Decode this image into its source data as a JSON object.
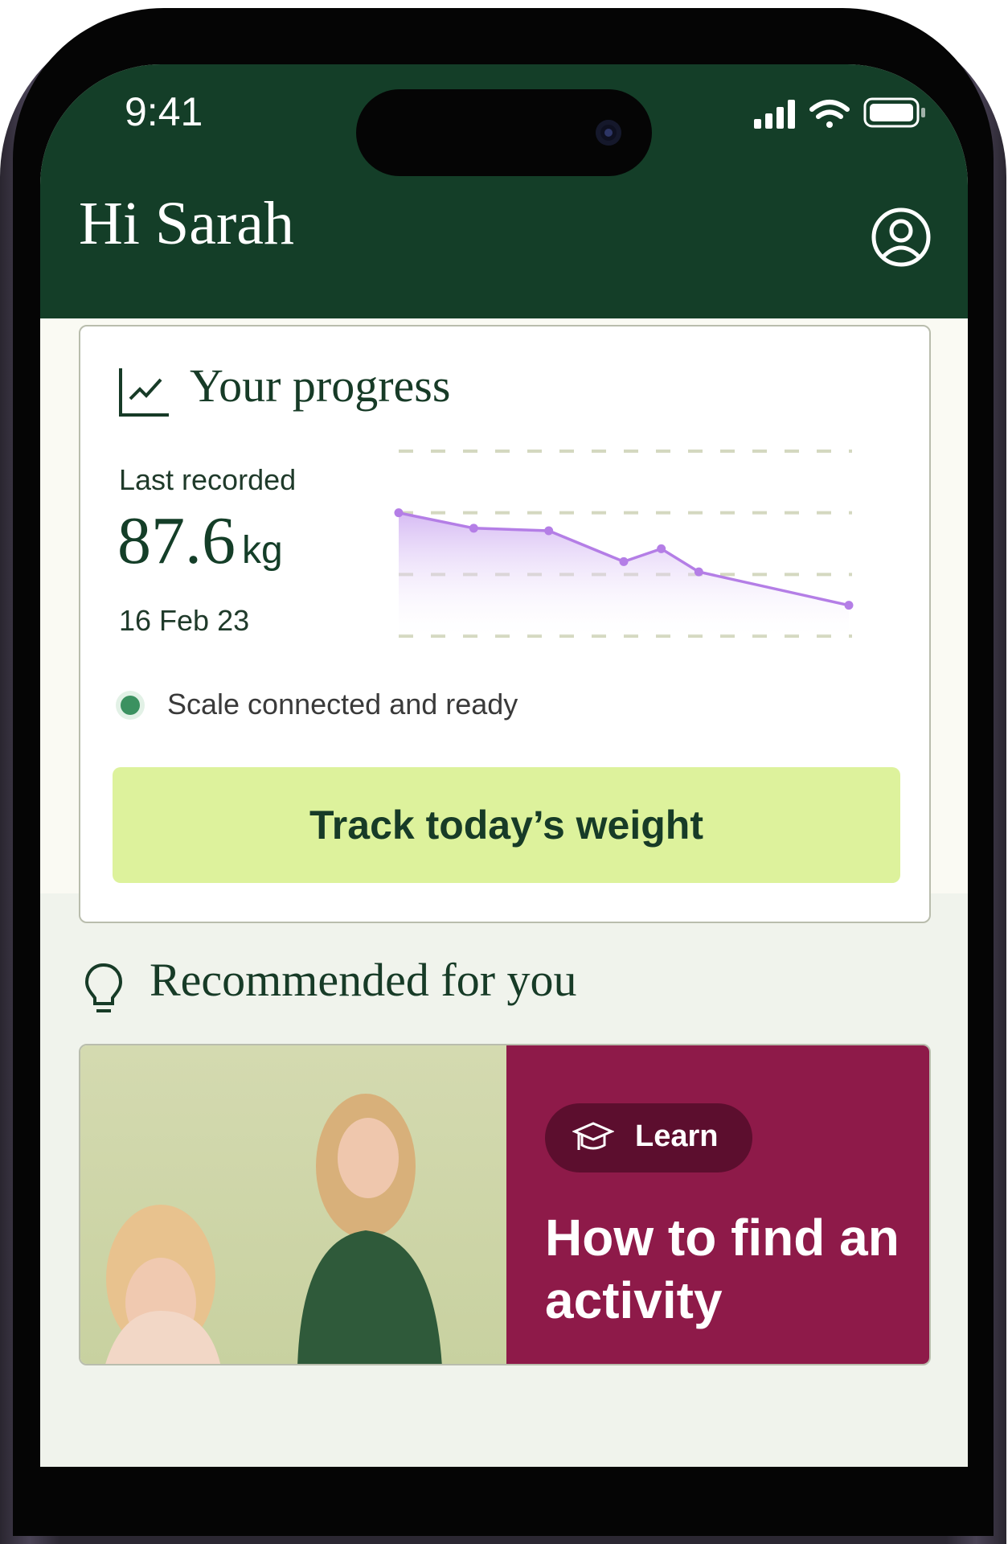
{
  "status_bar": {
    "time": "9:41"
  },
  "header": {
    "greeting": "Hi Sarah",
    "profile_icon": "user-circle-icon"
  },
  "progress_card": {
    "title": "Your progress",
    "title_icon": "line-chart-icon",
    "last_recorded_label": "Last recorded",
    "weight_value": "87.6",
    "weight_unit": "kg",
    "date": "16 Feb 23",
    "connection_status": "Scale connected and ready",
    "track_button_label": "Track today’s weight",
    "colors": {
      "line": "#b47ee6",
      "status_dot": "#3b9160",
      "button": "#ddf29c"
    }
  },
  "chart_data": {
    "type": "area",
    "title": "",
    "xlabel": "",
    "ylabel": "",
    "grid": true,
    "x": [
      0,
      1,
      2,
      3,
      3.5,
      4,
      6
    ],
    "values": [
      91.2,
      90.6,
      90.5,
      89.3,
      89.8,
      88.9,
      87.6
    ],
    "ylim": [
      86.4,
      93.6
    ],
    "gridlines": [
      93.6,
      91.2,
      88.8,
      86.4
    ]
  },
  "recommended": {
    "title": "Recommended for you",
    "title_icon": "lightbulb-icon",
    "card": {
      "badge_label": "Learn",
      "badge_icon": "graduation-cap-icon",
      "headline": "How to find an activity"
    }
  }
}
